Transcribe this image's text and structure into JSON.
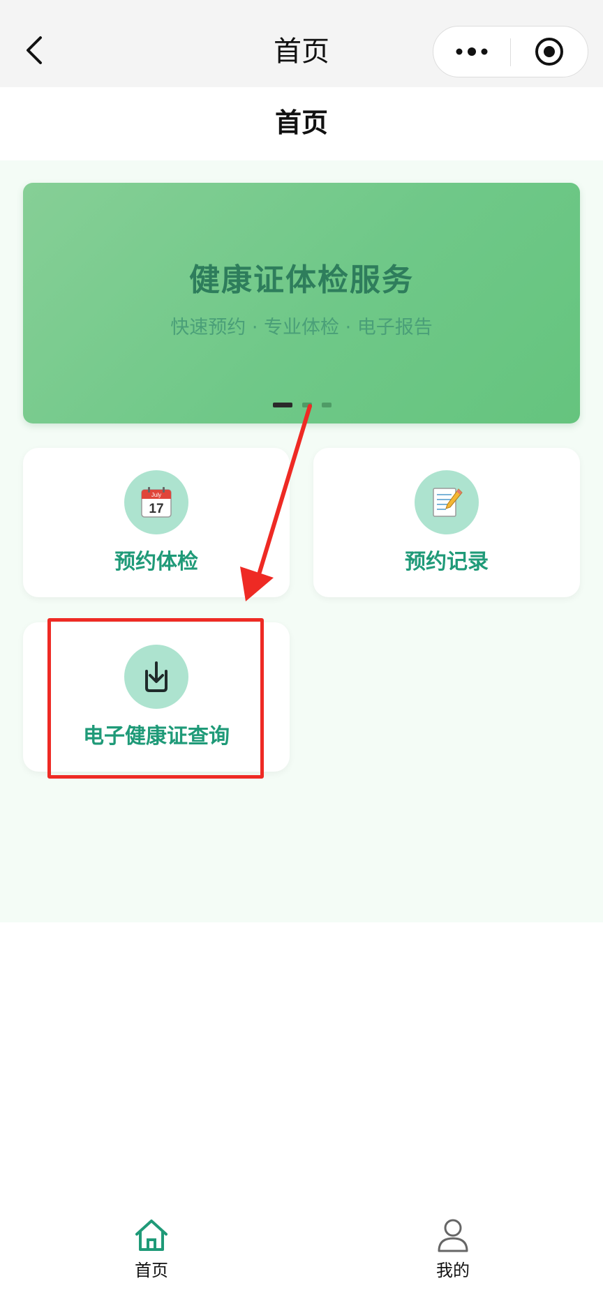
{
  "nav": {
    "title": "首页"
  },
  "page": {
    "title": "首页"
  },
  "banner": {
    "title": "健康证体检服务",
    "subtitle": "快速预约 · 专业体检 · 电子报告",
    "active_slide": 1,
    "slide_count": 3
  },
  "cards": [
    {
      "label": "预约体检",
      "icon": "calendar-icon",
      "calendar_month": "July",
      "calendar_day": "17"
    },
    {
      "label": "预约记录",
      "icon": "memo-icon"
    },
    {
      "label": "电子健康证查询",
      "icon": "download-icon"
    }
  ],
  "tabbar": {
    "items": [
      {
        "label": "首页",
        "icon": "home-icon",
        "active": true
      },
      {
        "label": "我的",
        "icon": "user-icon",
        "active": false
      }
    ]
  },
  "colors": {
    "accent": "#1f9a78",
    "banner": "#6fc888",
    "annotation": "#ee2a24"
  }
}
